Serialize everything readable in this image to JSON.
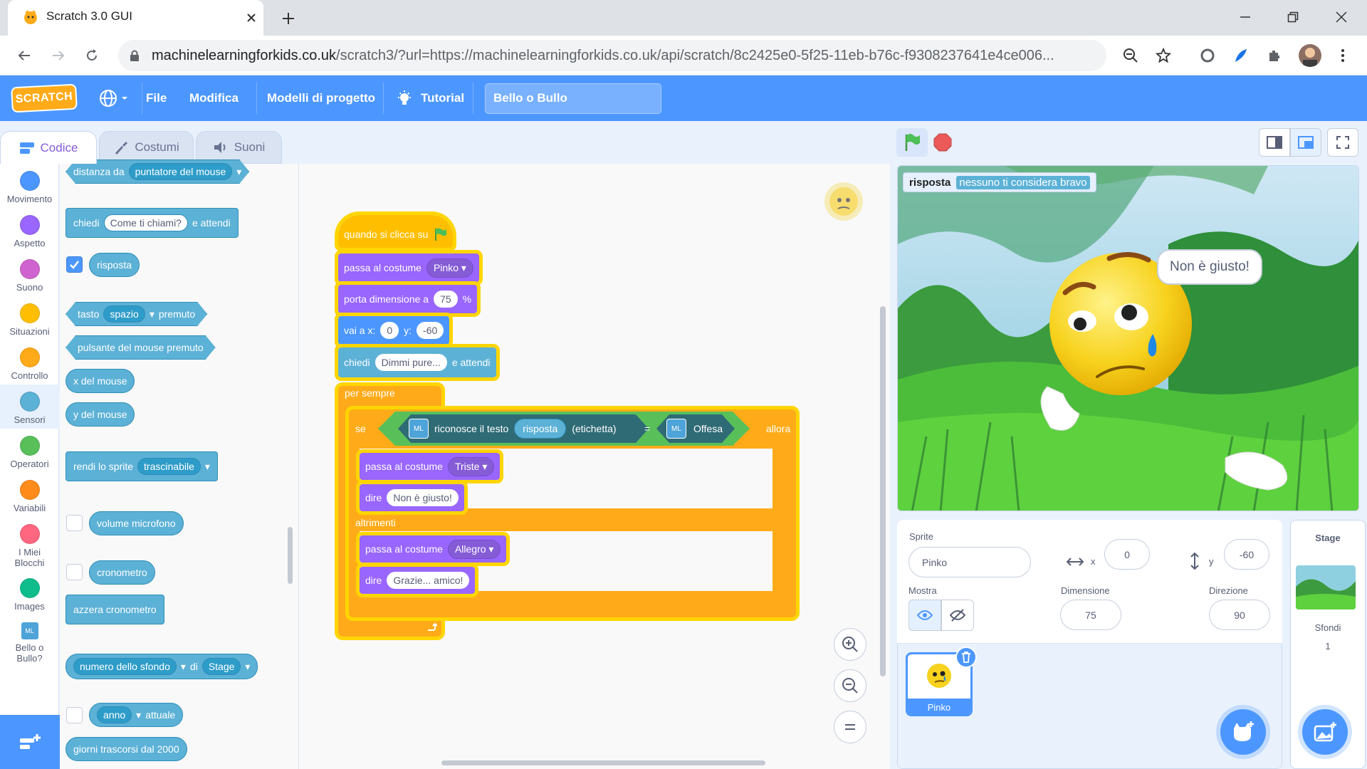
{
  "browser": {
    "tab_title": "Scratch 3.0 GUI",
    "url_domain": "machinelearningforkids.co.uk",
    "url_rest": "/scratch3/?url=https://machinelearningforkids.co.uk/api/scratch/8c2425e0-5f25-11eb-b76c-f9308237641e4ce006..."
  },
  "menu": {
    "logo": "SCRATCH",
    "file": "File",
    "edit": "Modifica",
    "templates": "Modelli di progetto",
    "tutorial": "Tutorial",
    "project_title": "Bello o Bullo"
  },
  "editor_tabs": {
    "code": "Codice",
    "costumes": "Costumi",
    "sounds": "Suoni"
  },
  "categories": [
    {
      "label": "Movimento",
      "color": "#4c97ff"
    },
    {
      "label": "Aspetto",
      "color": "#9966ff"
    },
    {
      "label": "Suono",
      "color": "#cf63cf"
    },
    {
      "label": "Situazioni",
      "color": "#ffbf00"
    },
    {
      "label": "Controllo",
      "color": "#ffab19"
    },
    {
      "label": "Sensori",
      "color": "#5cb1d6"
    },
    {
      "label": "Operatori",
      "color": "#59c059"
    },
    {
      "label": "Variabili",
      "color": "#ff8c1a"
    },
    {
      "label": "I Miei Blocchi",
      "color": "#ff6680"
    },
    {
      "label": "Images",
      "color": "#0fbd8c"
    },
    {
      "label": "Bello o Bullo?",
      "color": "#4ea3d8"
    }
  ],
  "palette": {
    "distance_to": "distanza da",
    "mouse_pointer": "puntatore del mouse",
    "ask": "chiedi",
    "ask_default": "Come ti chiami?",
    "and_wait": "e attendi",
    "answer": "risposta",
    "key": "tasto",
    "space": "spazio",
    "pressed": "premuto",
    "mouse_down": "pulsante del mouse premuto",
    "mouse_x": "x del mouse",
    "mouse_y": "y del mouse",
    "drag_mode": "rendi lo sprite",
    "draggable": "trascinabile",
    "loudness": "volume microfono",
    "timer": "cronometro",
    "reset_timer": "azzera cronometro",
    "backdrop_number": "numero dello sfondo",
    "of": "di",
    "stage": "Stage",
    "year": "anno",
    "current": "attuale",
    "days_since": "giorni trascorsi dal 2000"
  },
  "script": {
    "when_flag": "quando si clicca su",
    "switch_costume": "passa al costume",
    "costume_1": "Pinko",
    "set_size": "porta dimensione a",
    "size_val": "75",
    "percent": "%",
    "goto_x": "vai a x:",
    "x_val": "0",
    "y_label": "y:",
    "y_val": "-60",
    "ask": "chiedi",
    "ask_text": "Dimmi pure...",
    "and_wait": "e attendi",
    "forever": "per sempre",
    "if": "se",
    "recognise": "riconosce il testo",
    "answer": "risposta",
    "label": "(etichetta)",
    "equals": "=",
    "offesa": "Offesa",
    "then": "allora",
    "costume_2": "Triste",
    "say": "dire",
    "say_1": "Non è giusto!",
    "else": "altrimenti",
    "costume_3": "Allegro",
    "say_2": "Grazie... amico!"
  },
  "stage": {
    "monitor_label": "risposta",
    "monitor_value": "nessuno ti considera bravo",
    "speech": "Non è giusto!"
  },
  "sprite_info": {
    "sprite_label": "Sprite",
    "sprite_name": "Pinko",
    "x_label": "x",
    "x_value": "0",
    "y_label": "y",
    "y_value": "-60",
    "show_label": "Mostra",
    "size_label": "Dimensione",
    "size_value": "75",
    "direction_label": "Direzione",
    "direction_value": "90",
    "thumb_name": "Pinko"
  },
  "stage_panel": {
    "title": "Stage",
    "backdrops_label": "Sfondi",
    "backdrops_count": "1"
  }
}
